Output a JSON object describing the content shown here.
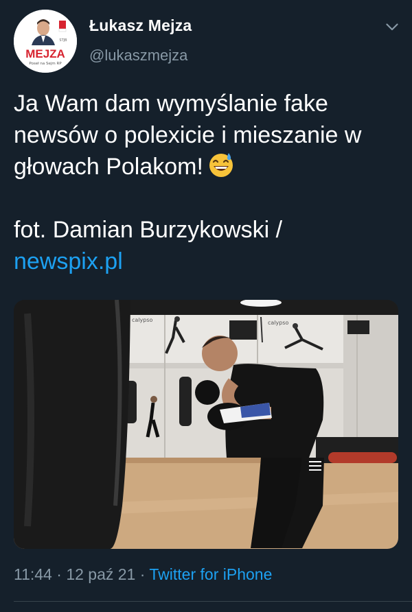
{
  "user": {
    "display_name": "Łukasz Mejza",
    "handle": "@lukaszmejza",
    "avatar_brand": "MEJZA",
    "avatar_subtitle": "Poseł na Sejm RP"
  },
  "tweet": {
    "line1": "Ja Wam dam wymyślanie fake newsów o polexicie i mieszanie w głowach Polakom!",
    "credit": "fot. Damian Burzykowski /",
    "link_text": "newspix.pl",
    "emoji": "grinning-face-with-sweat-emoji"
  },
  "photo": {
    "wall_label_1": "calypso",
    "wall_label_2": "calypso"
  },
  "footer": {
    "time": "11:44",
    "separator": "·",
    "date": "12 paź 21",
    "separator2": "·",
    "source": "Twitter for iPhone"
  },
  "colors": {
    "background": "#15202b",
    "text": "#ffffff",
    "secondary": "#8899a6",
    "link": "#1da1f2",
    "brand_red": "#d7232f"
  },
  "icons": {
    "more": "chevron-down-icon"
  }
}
